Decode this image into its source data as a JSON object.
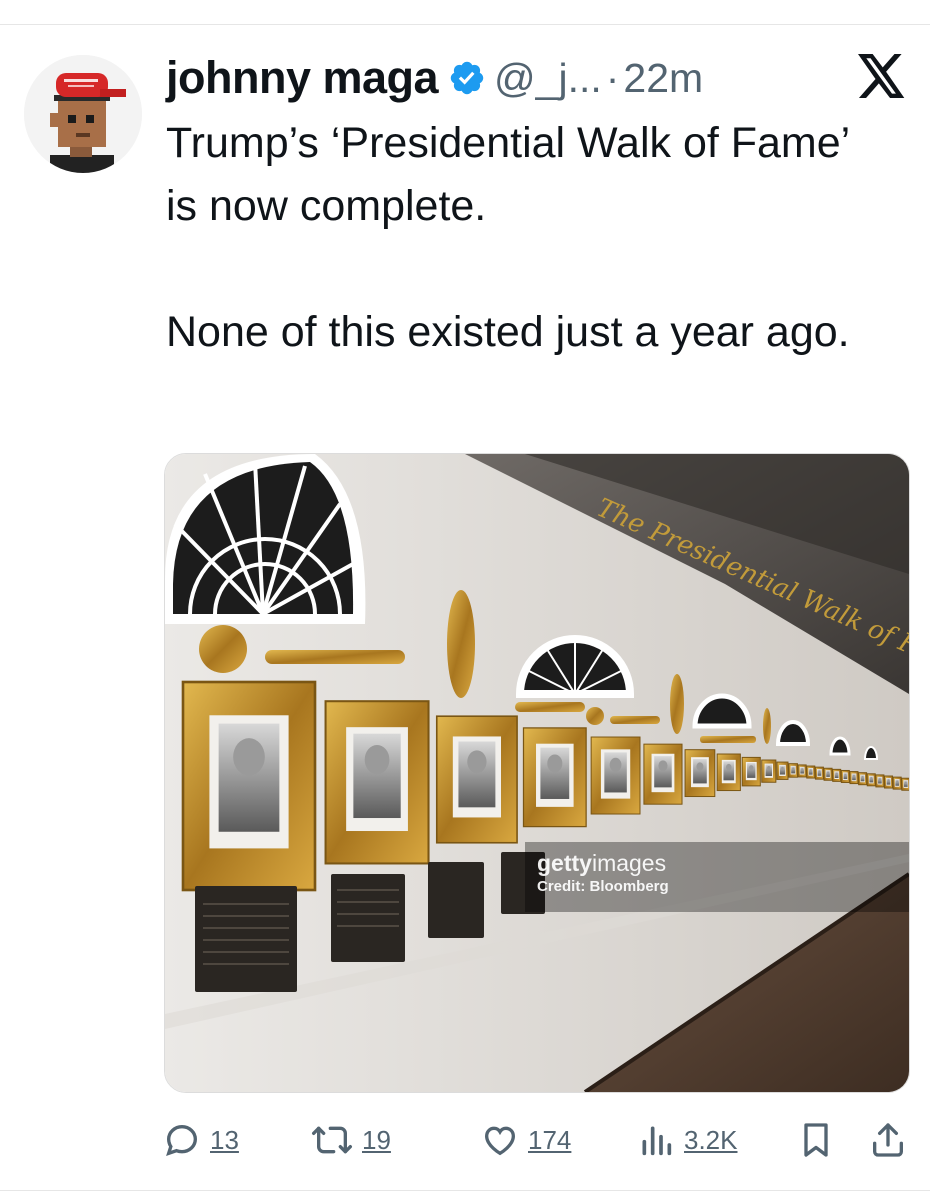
{
  "post": {
    "display_name": "johnny maga",
    "handle": "@_j...",
    "separator": "·",
    "time": "22m",
    "text": "Trump’s ‘Presidential Walk of Fame’ is now complete.\n\nNone of this existed just a year ago."
  },
  "media": {
    "signage": "The Presidential Walk of Fame",
    "watermark_brand_bold": "getty",
    "watermark_brand_light": "images",
    "watermark_credit": "Credit: Bloomberg"
  },
  "actions": {
    "replies": "13",
    "reposts": "19",
    "likes": "174",
    "views": "3.2K"
  },
  "icons": {
    "verified": "verified-badge-icon",
    "platform": "x-logo-icon",
    "reply": "reply-icon",
    "repost": "repost-icon",
    "like": "heart-icon",
    "views": "views-icon",
    "bookmark": "bookmark-icon",
    "share": "share-icon"
  },
  "colors": {
    "verified": "#1d9bf0",
    "text": "#0f1419",
    "secondary": "#536471",
    "frame_gold": "#b8892b"
  }
}
